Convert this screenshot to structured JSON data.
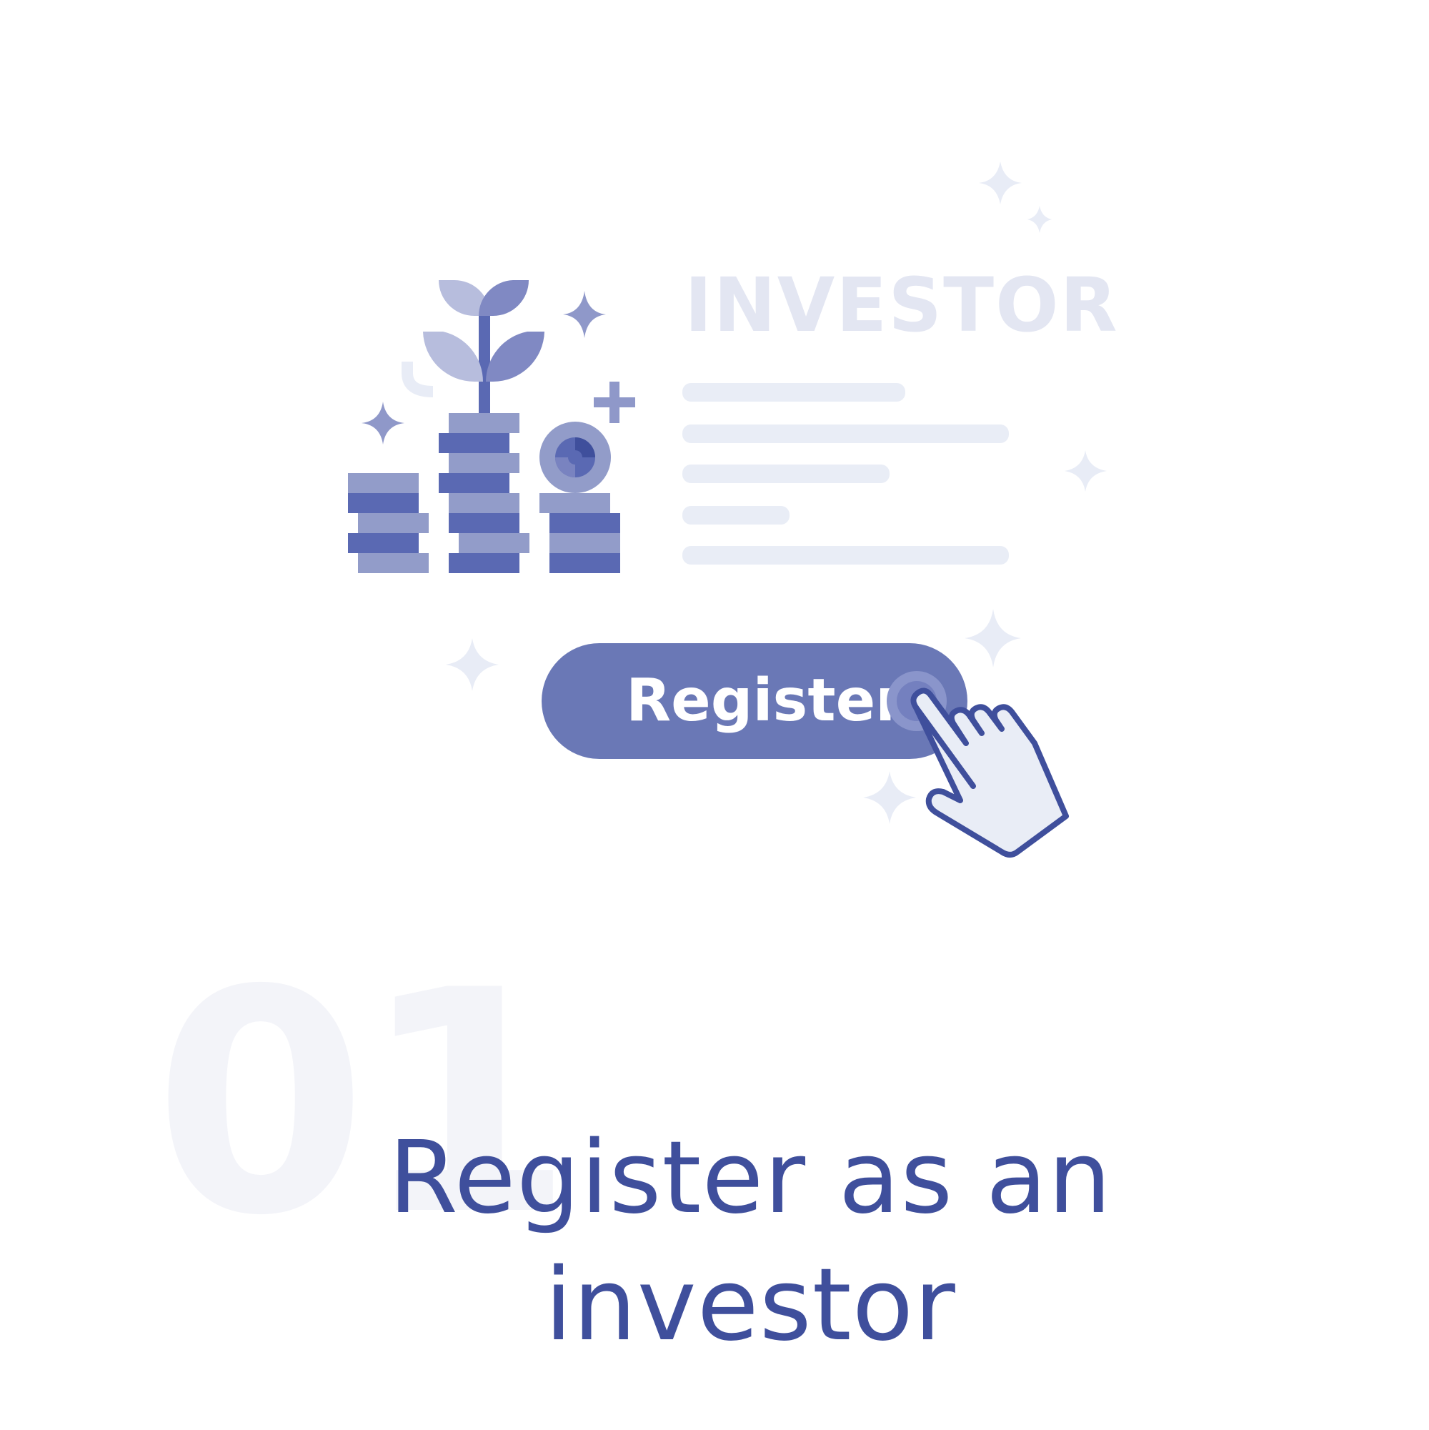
{
  "card": {
    "title": "INVESTOR",
    "register_button": "Register"
  },
  "step": {
    "number": "01",
    "title": "Register as an investor"
  },
  "icons": [
    "coins-stack-icon",
    "plant-sprout-icon",
    "coin-icon",
    "plus-icon",
    "sparkle-icon",
    "hand-pointer-icon"
  ],
  "colors": {
    "primary": "#3f4f9c",
    "button": "#6a78b6",
    "dark_coin": "#5a69b3",
    "light_coin": "#929cc9",
    "leaf_light": "#b7bddd",
    "form_line": "#e9edf6",
    "sparkle": "#e8ecf6",
    "number_watermark": "#f3f4f9"
  }
}
